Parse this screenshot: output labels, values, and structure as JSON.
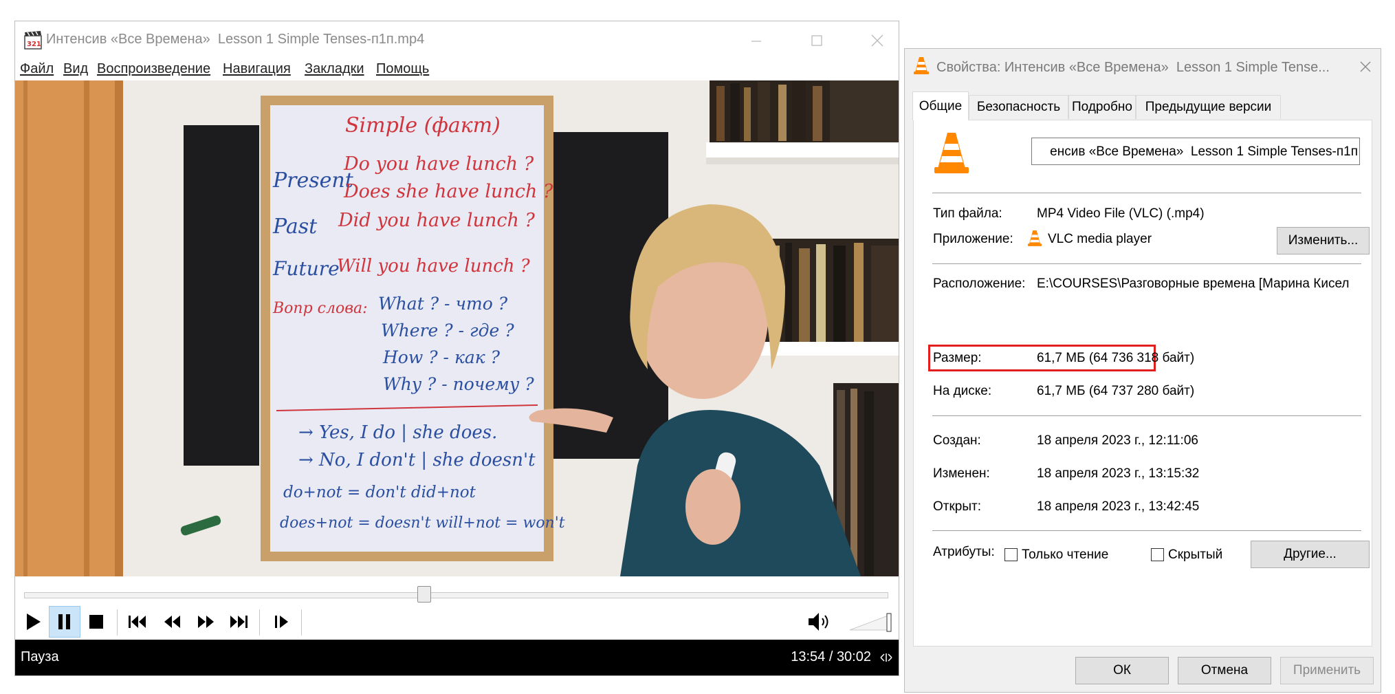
{
  "player": {
    "title": "Интенсив «Все Времена»  Lesson 1 Simple Tenses-п1п.mp4",
    "menu": [
      {
        "label": "Файл"
      },
      {
        "label": "Вид"
      },
      {
        "label": "Воспроизведение"
      },
      {
        "label": "Навигация"
      },
      {
        "label": "Закладки"
      },
      {
        "label": "Помощь"
      }
    ],
    "status": "Пауза",
    "time": "13:54 / 30:02",
    "progress_fraction": 0.463
  },
  "whiteboard": {
    "title": "Simple (факт)",
    "lines": [
      "Present",
      "Do you have lunch ?",
      "Does she have lunch ?",
      "Past",
      "Did you have lunch ?",
      "Future",
      "Will you have lunch ?",
      "Вопр слова:",
      "What ? - что ?",
      "Where ? - где ?",
      "How ? - как ?",
      "Why ? - почему ?",
      "→ Yes, I do | she does.",
      "→ No, I don't | she doesn't",
      "do+not = don't   did+not",
      "does+not = doesn't  will+not = won't"
    ]
  },
  "dialog": {
    "title": "Свойства: Интенсив «Все Времена»  Lesson 1 Simple Tense...",
    "tabs": [
      "Общие",
      "Безопасность",
      "Подробно",
      "Предыдущие версии"
    ],
    "filename_field": "енсив «Все Времена»  Lesson 1 Simple Tenses-п1п",
    "rows": {
      "type_label": "Тип файла:",
      "type_value": "MP4 Video File (VLC) (.mp4)",
      "app_label": "Приложение:",
      "app_value": "VLC media player",
      "change_button": "Изменить...",
      "location_label": "Расположение:",
      "location_value": "E:\\COURSES\\Разговорные времена [Марина Кисел",
      "size_label": "Размер:",
      "size_value": "61,7 МБ (64 736 318 байт)",
      "disk_label": "На диске:",
      "disk_value": "61,7 МБ (64 737 280 байт)",
      "created_label": "Создан:",
      "created_value": "18 апреля 2023 г., 12:11:06",
      "modified_label": "Изменен:",
      "modified_value": "18 апреля 2023 г., 13:15:32",
      "opened_label": "Открыт:",
      "opened_value": "18 апреля 2023 г., 13:42:45",
      "attrs_label": "Атрибуты:",
      "readonly_label": "Только чтение",
      "hidden_label": "Скрытый",
      "other_button": "Другие..."
    },
    "buttons": {
      "ok": "ОК",
      "cancel": "Отмена",
      "apply": "Применить"
    }
  },
  "colors": {
    "highlight": "#e21e1e",
    "vlc_orange": "#ff8800",
    "board_red": "#d0343c",
    "board_blue": "#2a4fa0"
  }
}
